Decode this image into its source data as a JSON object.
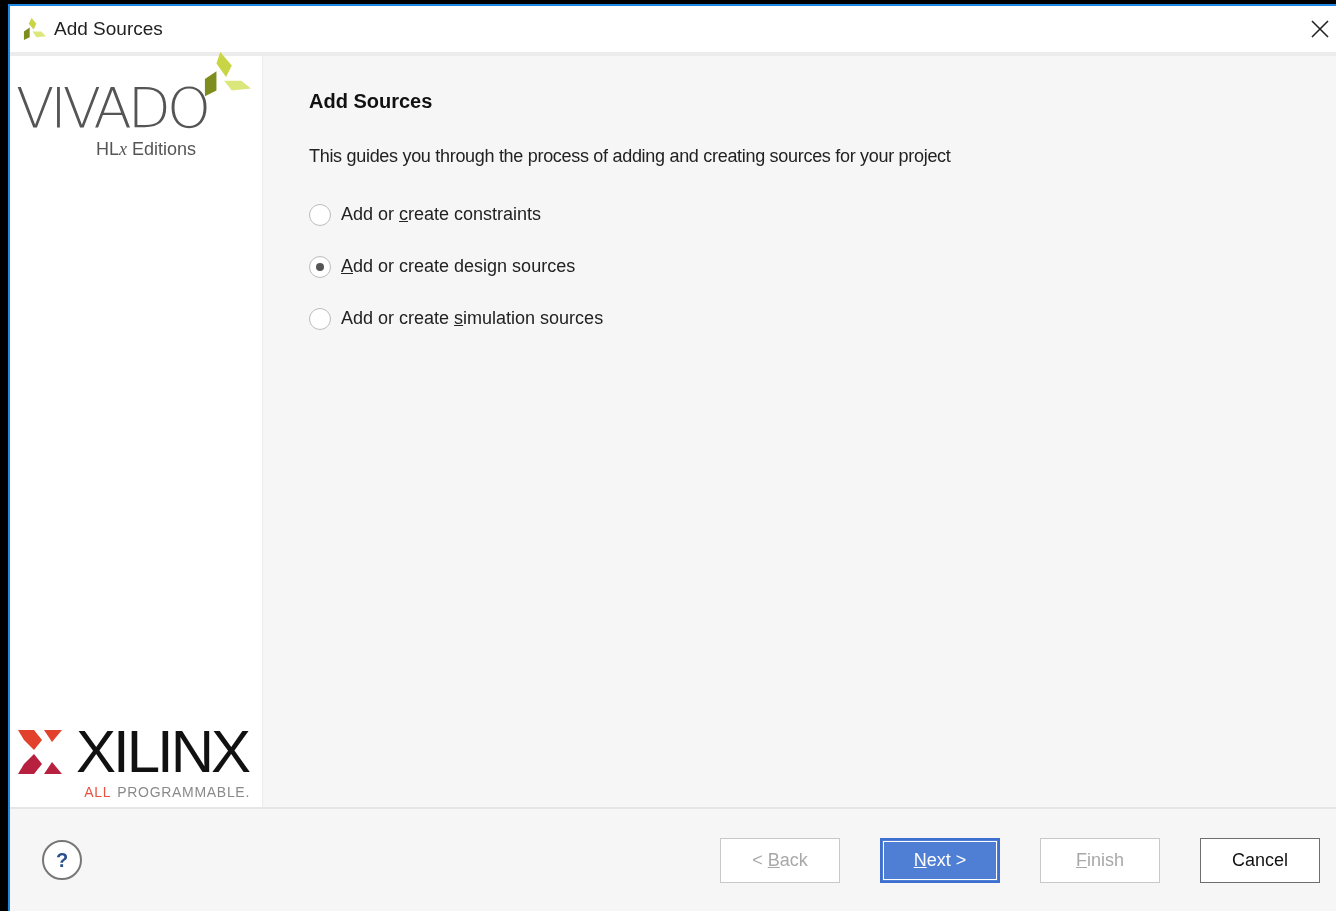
{
  "window": {
    "title": "Add Sources"
  },
  "logo": {
    "product": "VIVADO",
    "edition": {
      "before": "HL",
      "key": "x",
      "after": " Editions"
    },
    "company": "XILINX",
    "tagline_accent": "ALL",
    "tagline": "PROGRAMMABLE."
  },
  "heading": "Add Sources",
  "description": "This guides you through the process of adding and creating sources for your project",
  "options": [
    {
      "label": {
        "before": "Add or ",
        "key": "c",
        "after": "reate constraints"
      },
      "selected": false
    },
    {
      "label": {
        "key": "A",
        "after": "dd or create design sources"
      },
      "selected": true
    },
    {
      "label": {
        "before": "Add or create ",
        "key": "s",
        "after": "imulation sources"
      },
      "selected": false
    }
  ],
  "help": {
    "label": "?"
  },
  "buttons": [
    {
      "label": {
        "before": "< ",
        "key": "B",
        "after": "ack"
      },
      "disabled": true,
      "default": false
    },
    {
      "label": {
        "key": "N",
        "after": "ext >"
      },
      "disabled": false,
      "default": true
    },
    {
      "label": {
        "key": "F",
        "after": "inish"
      },
      "disabled": true,
      "default": false
    },
    {
      "label": {
        "before": "Cancel"
      },
      "disabled": false,
      "default": false
    }
  ]
}
